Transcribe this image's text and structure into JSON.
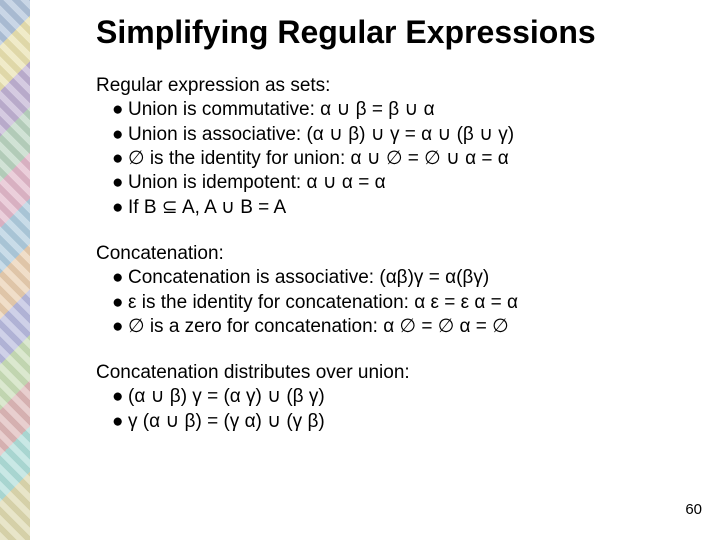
{
  "title": "Simplifying Regular Expressions",
  "sections": [
    {
      "heading": "Regular expression as sets:",
      "bullets": [
        "Union is commutative:  α ∪ β = β ∪ α",
        "Union is associative: (α ∪ β) ∪ γ = α ∪ (β ∪ γ)",
        "∅ is the identity for union:  α ∪ ∅ = ∅ ∪ α = α",
        "Union is idempotent:  α ∪ α =  α",
        "If B ⊆ A,  A ∪ B = A"
      ]
    },
    {
      "heading": "Concatenation:",
      "bullets": [
        "Concatenation is associative:  (αβ)γ = α(βγ)",
        "ε is the identity for concatenation:  α ε = ε α = α",
        "∅ is a zero for concatenation:  α ∅ = ∅ α = ∅"
      ]
    },
    {
      "heading": "Concatenation distributes over union:",
      "bullets": [
        "(α ∪ β) γ = (α γ) ∪ (β γ)",
        "γ (α ∪ β) = (γ α) ∪ (γ β)"
      ]
    }
  ],
  "bullet_glyph": "●",
  "page_number": "60"
}
